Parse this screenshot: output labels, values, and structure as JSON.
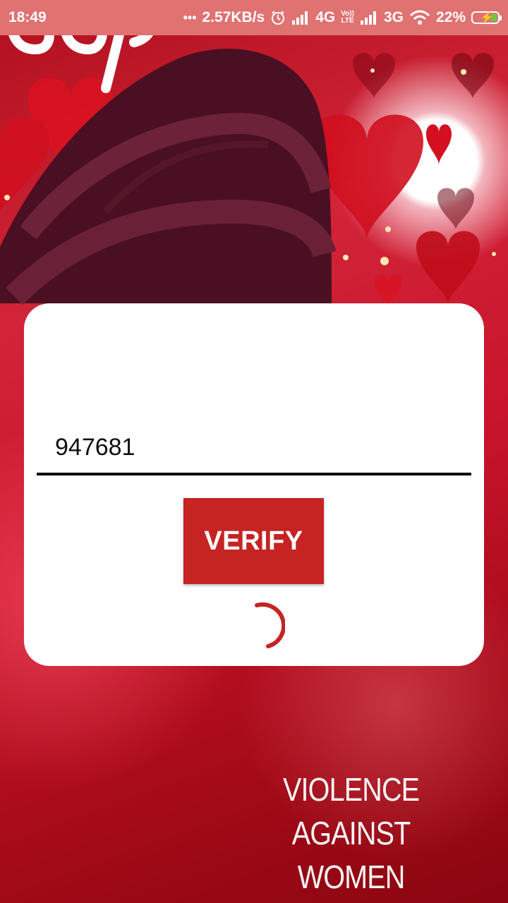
{
  "status_bar": {
    "time": "18:49",
    "dots": "•••",
    "speed": "2.57KB/s",
    "net1": "4G",
    "volte_top": "Vo))",
    "volte_bottom": "LTE",
    "net2": "3G",
    "battery": "22%",
    "battery_color": "#6ccb3c"
  },
  "dialog": {
    "otp_value": "947681",
    "verify_label": "VERIFY",
    "accent": "#c62323"
  },
  "background": {
    "slogan_line1": "VIOLENCE AGAINST",
    "slogan_line2": "WOMEN"
  }
}
